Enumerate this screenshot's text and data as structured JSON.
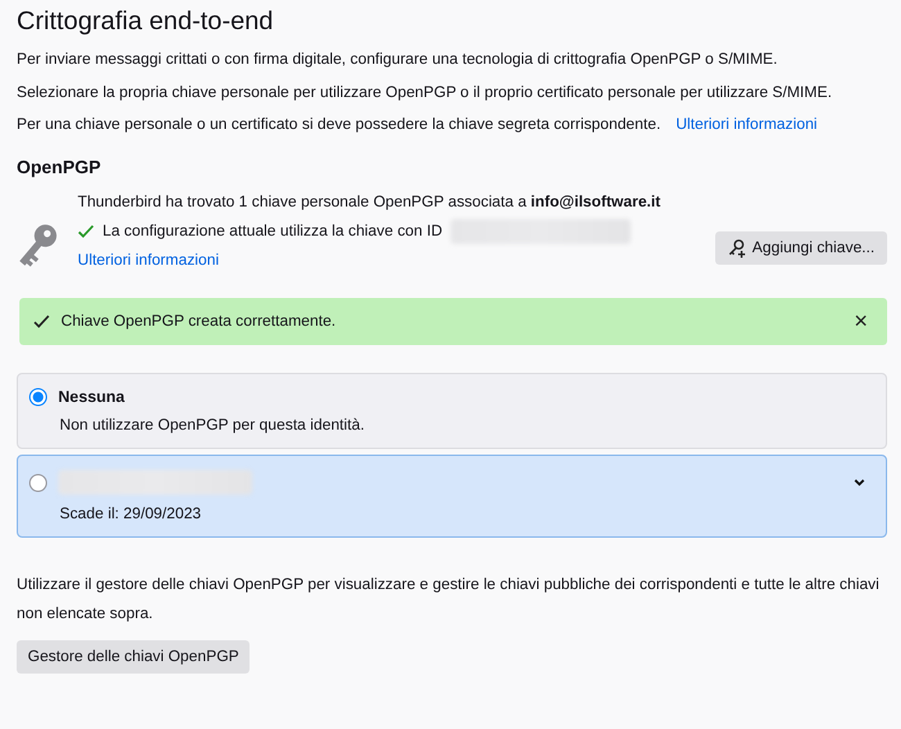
{
  "heading": "Crittografia end-to-end",
  "intro": [
    "Per inviare messaggi crittati o con firma digitale, configurare una tecnologia di crittografia OpenPGP o S/MIME.",
    "Selezionare la propria chiave personale per utilizzare OpenPGP o il proprio certificato personale per utilizzare S/MIME."
  ],
  "intro_last": {
    "text": "Per una chiave personale o un certificato si deve possedere la chiave segreta corrispondente.",
    "link": "Ulteriori informazioni"
  },
  "openpgp": {
    "title": "OpenPGP",
    "found": "Thunderbird ha trovato 1 chiave personale OpenPGP associata a **info@ilsoftware.it**",
    "current": "La configurazione attuale utilizza la chiave con ID",
    "link": "Ulteriori informazioni",
    "button": "Aggiungi chiave..."
  },
  "notice": {
    "text": "Chiave OpenPGP creata correttamente.",
    "close": "×"
  },
  "options": [
    {
      "kind": "none",
      "title": "Nessuna",
      "description": "Non utilizzare OpenPGP per questa identità.",
      "selected": true,
      "highlighted": false
    },
    {
      "kind": "key",
      "description": "Scade il: 29/09/2023",
      "selected": false,
      "highlighted": true
    }
  ],
  "footer": {
    "text": "Utilizzare il gestore delle chiavi OpenPGP per visualizzare e gestire le chiavi pubbliche dei corrispondenti e tutte le altre chiavi non elencate sopra.",
    "button": "Gestore delle chiavi OpenPGP"
  }
}
